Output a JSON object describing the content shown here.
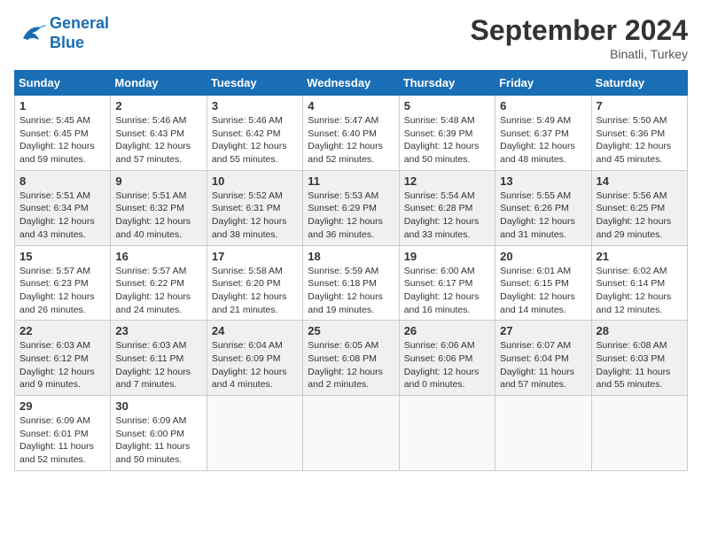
{
  "header": {
    "logo_line1": "General",
    "logo_line2": "Blue",
    "month_title": "September 2024",
    "subtitle": "Binatli, Turkey"
  },
  "weekdays": [
    "Sunday",
    "Monday",
    "Tuesday",
    "Wednesday",
    "Thursday",
    "Friday",
    "Saturday"
  ],
  "weeks": [
    [
      {
        "day": "1",
        "info": "Sunrise: 5:45 AM\nSunset: 6:45 PM\nDaylight: 12 hours\nand 59 minutes."
      },
      {
        "day": "2",
        "info": "Sunrise: 5:46 AM\nSunset: 6:43 PM\nDaylight: 12 hours\nand 57 minutes."
      },
      {
        "day": "3",
        "info": "Sunrise: 5:46 AM\nSunset: 6:42 PM\nDaylight: 12 hours\nand 55 minutes."
      },
      {
        "day": "4",
        "info": "Sunrise: 5:47 AM\nSunset: 6:40 PM\nDaylight: 12 hours\nand 52 minutes."
      },
      {
        "day": "5",
        "info": "Sunrise: 5:48 AM\nSunset: 6:39 PM\nDaylight: 12 hours\nand 50 minutes."
      },
      {
        "day": "6",
        "info": "Sunrise: 5:49 AM\nSunset: 6:37 PM\nDaylight: 12 hours\nand 48 minutes."
      },
      {
        "day": "7",
        "info": "Sunrise: 5:50 AM\nSunset: 6:36 PM\nDaylight: 12 hours\nand 45 minutes."
      }
    ],
    [
      {
        "day": "8",
        "info": "Sunrise: 5:51 AM\nSunset: 6:34 PM\nDaylight: 12 hours\nand 43 minutes."
      },
      {
        "day": "9",
        "info": "Sunrise: 5:51 AM\nSunset: 6:32 PM\nDaylight: 12 hours\nand 40 minutes."
      },
      {
        "day": "10",
        "info": "Sunrise: 5:52 AM\nSunset: 6:31 PM\nDaylight: 12 hours\nand 38 minutes."
      },
      {
        "day": "11",
        "info": "Sunrise: 5:53 AM\nSunset: 6:29 PM\nDaylight: 12 hours\nand 36 minutes."
      },
      {
        "day": "12",
        "info": "Sunrise: 5:54 AM\nSunset: 6:28 PM\nDaylight: 12 hours\nand 33 minutes."
      },
      {
        "day": "13",
        "info": "Sunrise: 5:55 AM\nSunset: 6:26 PM\nDaylight: 12 hours\nand 31 minutes."
      },
      {
        "day": "14",
        "info": "Sunrise: 5:56 AM\nSunset: 6:25 PM\nDaylight: 12 hours\nand 29 minutes."
      }
    ],
    [
      {
        "day": "15",
        "info": "Sunrise: 5:57 AM\nSunset: 6:23 PM\nDaylight: 12 hours\nand 26 minutes."
      },
      {
        "day": "16",
        "info": "Sunrise: 5:57 AM\nSunset: 6:22 PM\nDaylight: 12 hours\nand 24 minutes."
      },
      {
        "day": "17",
        "info": "Sunrise: 5:58 AM\nSunset: 6:20 PM\nDaylight: 12 hours\nand 21 minutes."
      },
      {
        "day": "18",
        "info": "Sunrise: 5:59 AM\nSunset: 6:18 PM\nDaylight: 12 hours\nand 19 minutes."
      },
      {
        "day": "19",
        "info": "Sunrise: 6:00 AM\nSunset: 6:17 PM\nDaylight: 12 hours\nand 16 minutes."
      },
      {
        "day": "20",
        "info": "Sunrise: 6:01 AM\nSunset: 6:15 PM\nDaylight: 12 hours\nand 14 minutes."
      },
      {
        "day": "21",
        "info": "Sunrise: 6:02 AM\nSunset: 6:14 PM\nDaylight: 12 hours\nand 12 minutes."
      }
    ],
    [
      {
        "day": "22",
        "info": "Sunrise: 6:03 AM\nSunset: 6:12 PM\nDaylight: 12 hours\nand 9 minutes."
      },
      {
        "day": "23",
        "info": "Sunrise: 6:03 AM\nSunset: 6:11 PM\nDaylight: 12 hours\nand 7 minutes."
      },
      {
        "day": "24",
        "info": "Sunrise: 6:04 AM\nSunset: 6:09 PM\nDaylight: 12 hours\nand 4 minutes."
      },
      {
        "day": "25",
        "info": "Sunrise: 6:05 AM\nSunset: 6:08 PM\nDaylight: 12 hours\nand 2 minutes."
      },
      {
        "day": "26",
        "info": "Sunrise: 6:06 AM\nSunset: 6:06 PM\nDaylight: 12 hours\nand 0 minutes."
      },
      {
        "day": "27",
        "info": "Sunrise: 6:07 AM\nSunset: 6:04 PM\nDaylight: 11 hours\nand 57 minutes."
      },
      {
        "day": "28",
        "info": "Sunrise: 6:08 AM\nSunset: 6:03 PM\nDaylight: 11 hours\nand 55 minutes."
      }
    ],
    [
      {
        "day": "29",
        "info": "Sunrise: 6:09 AM\nSunset: 6:01 PM\nDaylight: 11 hours\nand 52 minutes."
      },
      {
        "day": "30",
        "info": "Sunrise: 6:09 AM\nSunset: 6:00 PM\nDaylight: 11 hours\nand 50 minutes."
      },
      {
        "day": "",
        "info": ""
      },
      {
        "day": "",
        "info": ""
      },
      {
        "day": "",
        "info": ""
      },
      {
        "day": "",
        "info": ""
      },
      {
        "day": "",
        "info": ""
      }
    ]
  ]
}
